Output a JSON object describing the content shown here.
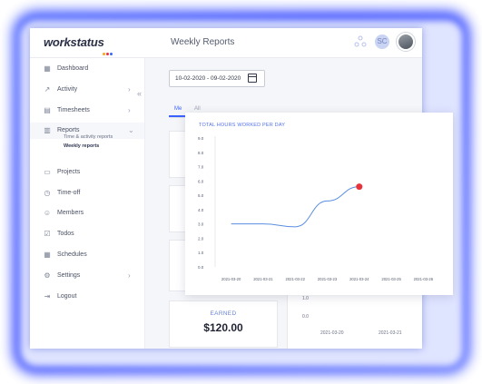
{
  "app": {
    "logo": "workstatus",
    "page_title": "Weekly Reports"
  },
  "colors": {
    "accent": "#3d63ff",
    "glow": "#2b3fff",
    "point": "#e8323c",
    "line": "#5b8fe0"
  },
  "header": {
    "icons": [
      "apps-icon",
      "profile-badge-icon"
    ],
    "badge_text": "SC"
  },
  "sidebar": {
    "items": [
      {
        "label": "Dashboard",
        "icon": "dashboard-icon",
        "chevron": false
      },
      {
        "label": "Activity",
        "icon": "activity-icon",
        "chevron": true
      },
      {
        "label": "Timesheets",
        "icon": "timesheets-icon",
        "chevron": true
      },
      {
        "label": "Reports",
        "icon": "reports-icon",
        "chevron": true
      },
      {
        "label": "Projects",
        "icon": "projects-icon",
        "chevron": false
      },
      {
        "label": "Time-off",
        "icon": "time-off-icon",
        "chevron": false
      },
      {
        "label": "Members",
        "icon": "members-icon",
        "chevron": false
      },
      {
        "label": "Todos",
        "icon": "todos-icon",
        "chevron": false
      },
      {
        "label": "Schedules",
        "icon": "schedules-icon",
        "chevron": false
      },
      {
        "label": "Settings",
        "icon": "settings-icon",
        "chevron": true
      },
      {
        "label": "Logout",
        "icon": "logout-icon",
        "chevron": false
      }
    ],
    "sub_items": [
      "Time & activity reports",
      "Weekly reports"
    ]
  },
  "filters": {
    "date_range": "10-02-2020 - 09-02-2020"
  },
  "tabs": [
    "Me",
    "All"
  ],
  "earned": {
    "label": "EARNED",
    "value": "$120.00"
  },
  "background_chart": {
    "y_ticks": [
      "1.0",
      "0.0"
    ],
    "x_ticks": [
      "2021-03-20",
      "2021-03-21"
    ]
  },
  "chart_data": {
    "type": "line",
    "title": "TOTAL HOURS WORKED PER DAY",
    "x": [
      "2021-03-20",
      "2021-03-21",
      "2021-03-22",
      "2021-03-23",
      "2021-03-24",
      "2021-03-25",
      "2021-03-26"
    ],
    "y_ticks": [
      "9.0",
      "8.0",
      "7.0",
      "6.0",
      "5.0",
      "4.0",
      "3.0",
      "2.0",
      "1.0",
      "0.0"
    ],
    "ylim": [
      0,
      9
    ],
    "series": [
      {
        "values": [
          3.0,
          3.0,
          2.8,
          4.6,
          5.6
        ],
        "x_positions": [
          0,
          1,
          2,
          3,
          4
        ]
      }
    ],
    "highlight_point": {
      "x": "2021-03-24",
      "y": 5.6
    },
    "grid": false,
    "legend": "none"
  }
}
